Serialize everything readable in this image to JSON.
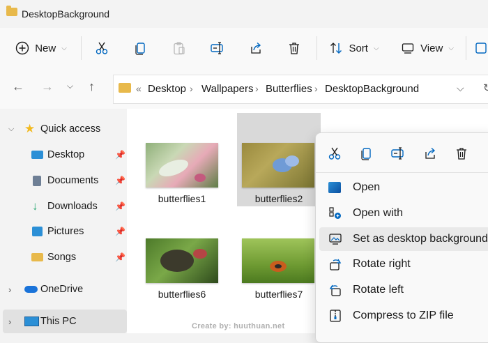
{
  "window": {
    "title": "DesktopBackground"
  },
  "toolbar": {
    "new_label": "New",
    "sort_label": "Sort",
    "view_label": "View",
    "icons": [
      "new-icon",
      "cut-icon",
      "copy-icon",
      "paste-icon",
      "rename-icon",
      "share-icon",
      "delete-icon",
      "sort-icon",
      "view-icon"
    ]
  },
  "address": {
    "overflow": "«",
    "crumbs": [
      "Desktop",
      "Wallpapers",
      "Butterflies",
      "DesktopBackground"
    ],
    "sep": "›"
  },
  "sidebar": {
    "quick_access": "Quick access",
    "items": [
      {
        "label": "Desktop"
      },
      {
        "label": "Documents"
      },
      {
        "label": "Downloads"
      },
      {
        "label": "Pictures"
      },
      {
        "label": "Songs"
      }
    ],
    "onedrive": "OneDrive",
    "thispc": "This PC"
  },
  "files": [
    {
      "name": "butterflies1"
    },
    {
      "name": "butterflies2"
    },
    {
      "name": "butterflies6"
    },
    {
      "name": "butterflies7"
    }
  ],
  "context_menu": {
    "items": [
      {
        "label": "Open"
      },
      {
        "label": "Open with"
      },
      {
        "label": "Set as desktop background"
      },
      {
        "label": "Rotate right"
      },
      {
        "label": "Rotate left"
      },
      {
        "label": "Compress to ZIP file"
      }
    ]
  },
  "watermark": "Create by: huuthuan.net",
  "colors": {
    "folder": "#e8b94b",
    "accent": "#0067c0",
    "selection": "#d9d9d9"
  }
}
